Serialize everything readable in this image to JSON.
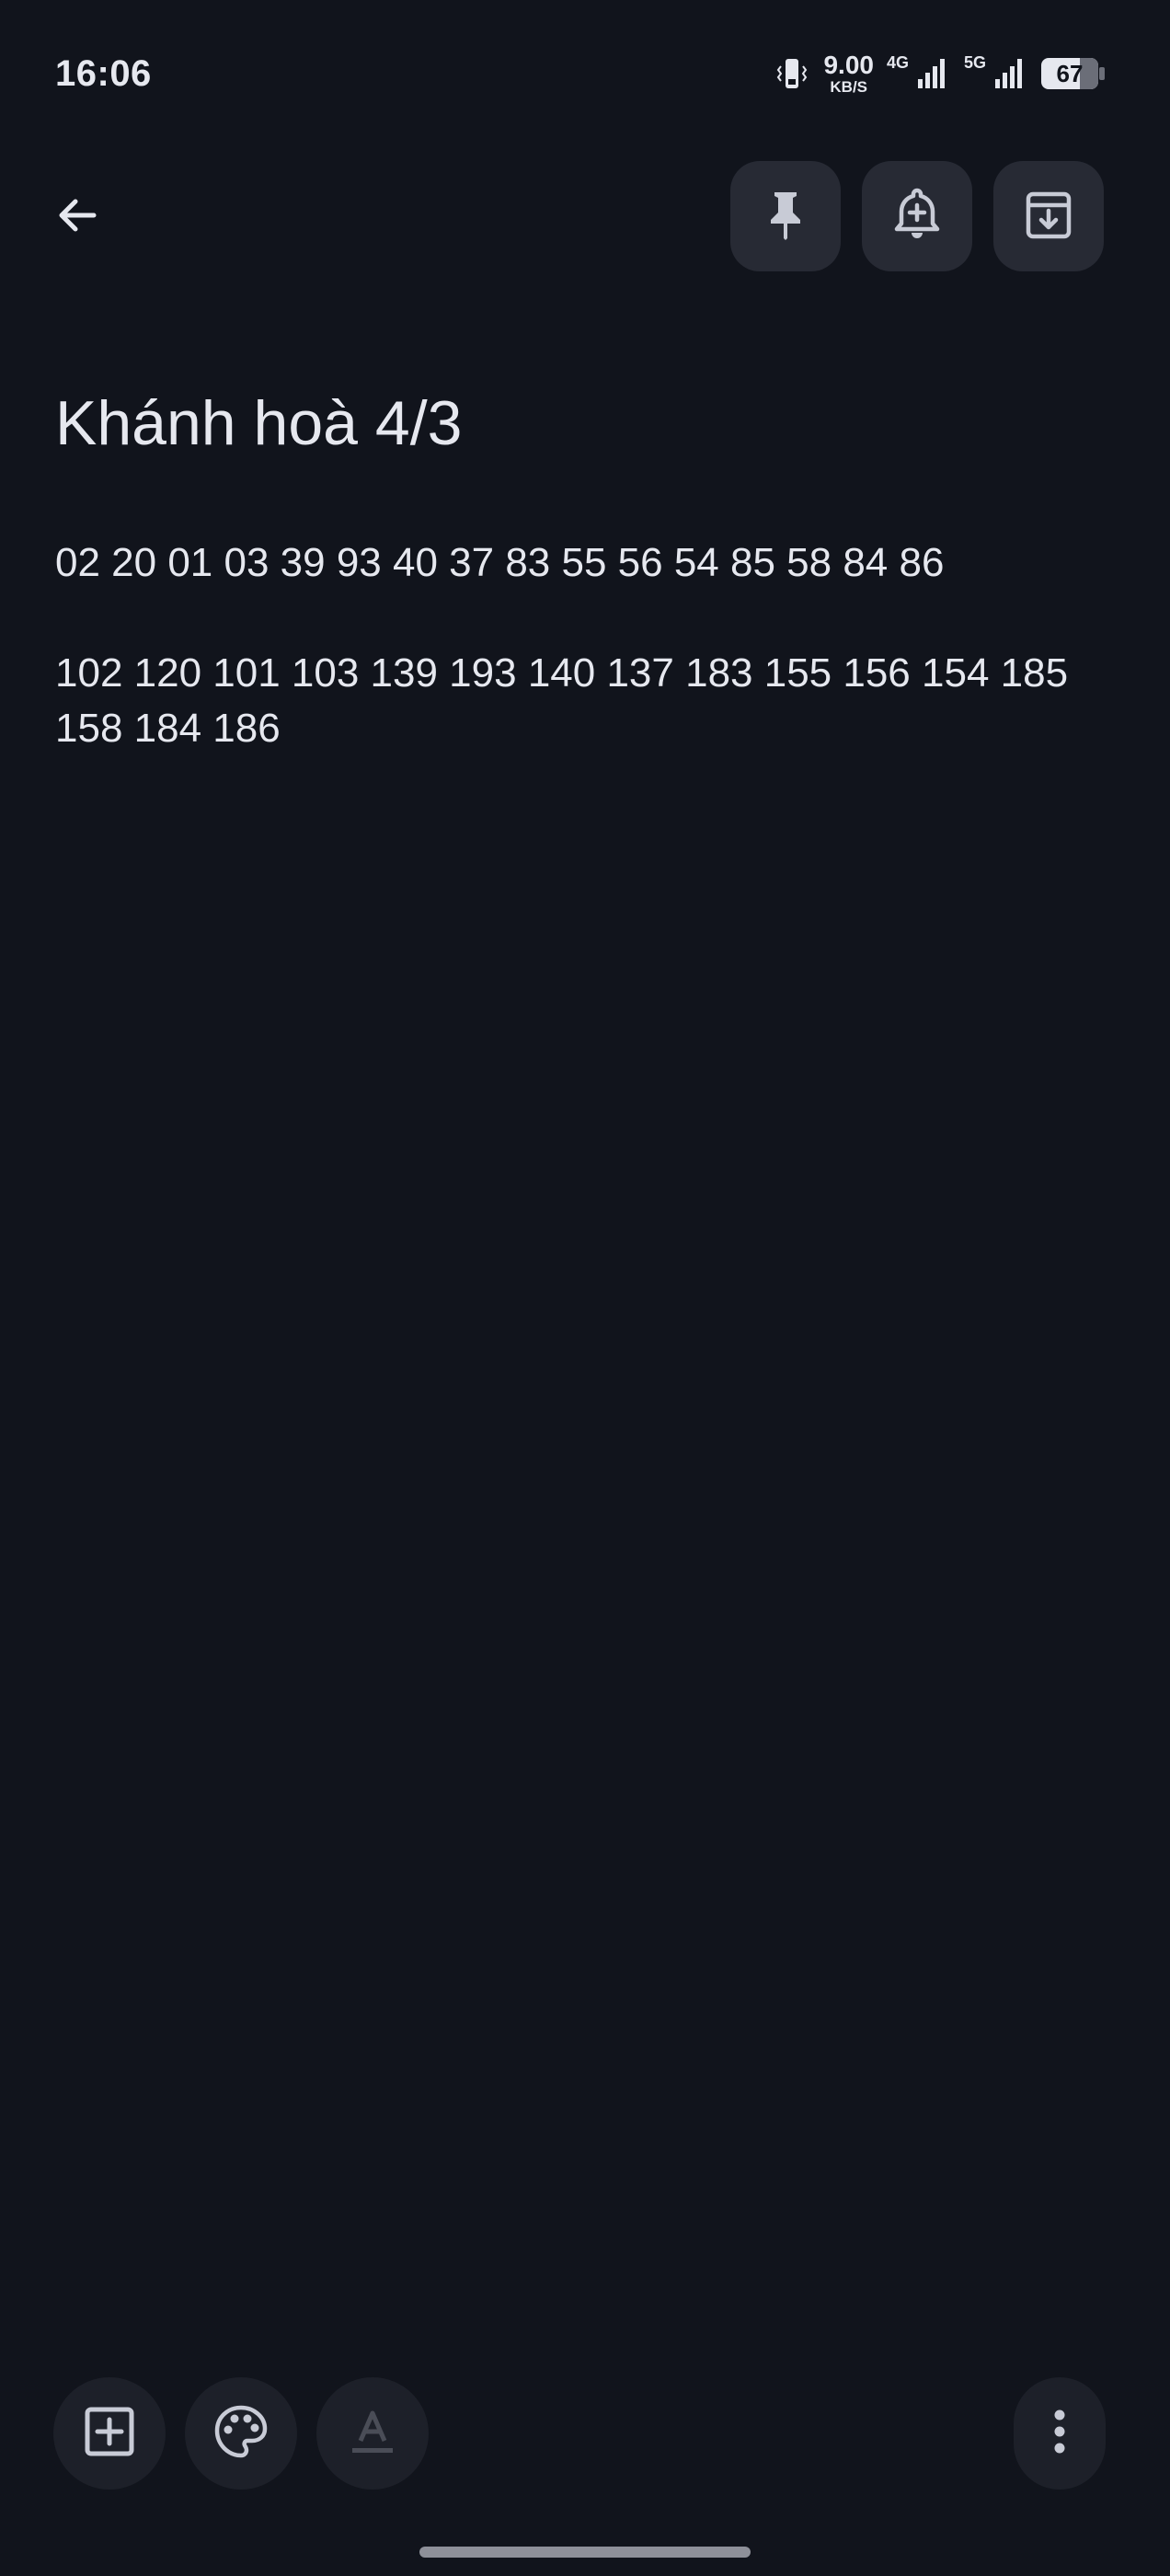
{
  "status_bar": {
    "time": "16:06",
    "net_speed_value": "9.00",
    "net_speed_unit": "KB/S",
    "network_label_1": "4G",
    "network_label_2": "5G",
    "battery_level": "67"
  },
  "note": {
    "title": "Khánh hoà 4/3",
    "paragraph_1": "02 20 01 03 39 93 40 37 83 55 56 54 85 58 84 86",
    "paragraph_2": "102 120 101 103 139 193 140 137 183 155 156 154 185 158 184 186"
  },
  "icons": {
    "back": "arrow-back-icon",
    "pin": "pin-icon",
    "reminder": "add-reminder-bell-icon",
    "archive": "archive-icon",
    "add": "add-box-icon",
    "palette": "palette-icon",
    "text_format": "text-format-icon",
    "more": "more-vertical-icon"
  },
  "colors": {
    "background": "#11141c",
    "toolbar_button": "#272a34",
    "bottom_button": "#1d2029",
    "text": "#e6e8ef",
    "disabled_icon": "#4a4d57"
  }
}
